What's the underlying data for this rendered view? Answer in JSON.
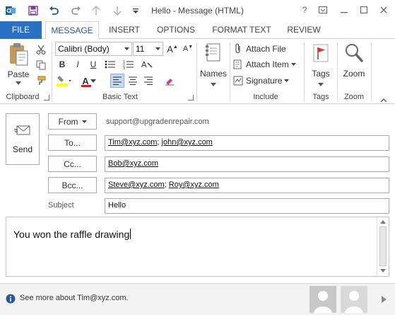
{
  "window": {
    "title": "Hello - Message (HTML)",
    "help_label": "?",
    "controls": [
      "ribbon-display-icon",
      "minimize-icon",
      "maximize-icon",
      "close-icon"
    ]
  },
  "quick_access": [
    "outlook-icon",
    "save-icon",
    "undo-icon",
    "redo-icon",
    "up-arrow-icon",
    "down-arrow-icon",
    "customize-icon"
  ],
  "tabs": [
    {
      "label": "FILE"
    },
    {
      "label": "MESSAGE"
    },
    {
      "label": "INSERT"
    },
    {
      "label": "OPTIONS"
    },
    {
      "label": "FORMAT TEXT"
    },
    {
      "label": "REVIEW"
    }
  ],
  "ribbon": {
    "clipboard": {
      "label": "Clipboard",
      "paste_label": "Paste"
    },
    "basic_text": {
      "label": "Basic Text",
      "font_name": "Calibri (Body)",
      "font_size": "11",
      "bold": "B",
      "italic": "I",
      "underline": "U",
      "font_color_letter": "A",
      "highlight_color": "#ffff00",
      "font_color": "#e81123"
    },
    "include": {
      "label": "Include",
      "attach_file": "Attach File",
      "attach_item": "Attach Item",
      "signature": "Signature"
    },
    "names_label": "Names",
    "tags": {
      "label": "Tags",
      "tags_label": "Tags"
    },
    "zoom": {
      "label": "Zoom",
      "zoom_label": "Zoom"
    }
  },
  "compose": {
    "send_label": "Send",
    "from_label": "From",
    "from_value": "support@upgradenrepair.com",
    "to_label": "To...",
    "to_recipients": [
      "Tim@xyz.com",
      "john@xyz.com"
    ],
    "cc_label": "Cc...",
    "cc_recipients": [
      "Bob@xyz.com"
    ],
    "bcc_label": "Bcc...",
    "bcc_recipients": [
      "Steve@xyz.com",
      "Roy@xyz.com"
    ],
    "subject_label": "Subject",
    "subject_value": "Hello",
    "body_text": "You won the raffle drawing"
  },
  "footer": {
    "see_more": "See more about Tim@xyz.com."
  },
  "colors": {
    "accent": "#2b579a",
    "file_tab": "#2a71c6"
  }
}
